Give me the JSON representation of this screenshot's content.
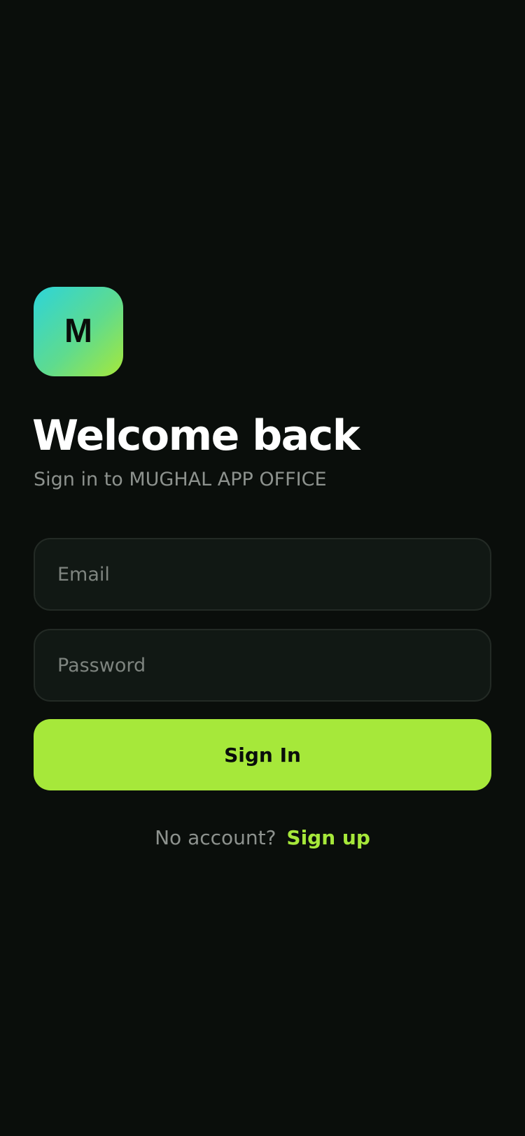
{
  "brand": {
    "logo_letter": "M",
    "accent_color": "#a6e83a",
    "logo_gradient": [
      "#2dd4d9",
      "#a6e83a"
    ]
  },
  "header": {
    "title": "Welcome back",
    "subtitle": "Sign in to MUGHAL APP OFFICE"
  },
  "form": {
    "email": {
      "value": "",
      "placeholder": "Email"
    },
    "password": {
      "value": "",
      "placeholder": "Password"
    },
    "submit_label": "Sign In"
  },
  "footer": {
    "prompt": "No account?",
    "link_label": "Sign up"
  },
  "colors": {
    "background": "#0a0e0b",
    "field_background": "#111814",
    "muted_text": "#8d928e"
  }
}
